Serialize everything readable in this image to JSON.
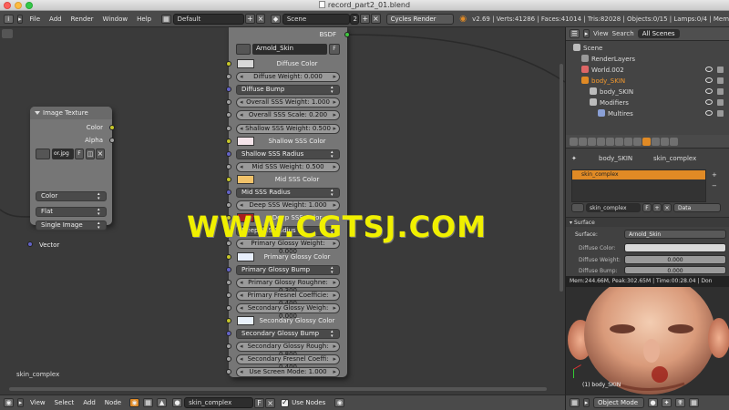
{
  "window": {
    "title": "record_part2_01.blend"
  },
  "info_header": {
    "menus": [
      "File",
      "Add",
      "Render",
      "Window",
      "Help"
    ],
    "screen_layout": "Default",
    "scene": "Scene",
    "scene_users": "2",
    "render_engine": "Cycles Render",
    "stats": "v2.69 | Verts:41286 | Faces:41014 | Tris:82028 | Objects:0/15 | Lamps:0/4 | Mem"
  },
  "image_texture_node": {
    "title": "Image Texture",
    "outputs": [
      "Color",
      "Alpha"
    ],
    "image_name": "or.jpg",
    "image_flag": "F",
    "color_space": "Color",
    "projection": "Flat",
    "source": "Single Image",
    "input": "Vector"
  },
  "shader_node": {
    "output_label": "BSDF",
    "shader_name": "Arnold_Skin",
    "shader_flag": "F",
    "rows": {
      "diffuse_color": "Diffuse Color",
      "diffuse_weight": "Diffuse Weight: 0.000",
      "diffuse_bump": "Diffuse Bump",
      "overall_sss_weight": "Overall SSS Weight: 1.000",
      "overall_sss_scale": "Overall SSS Scale: 0.200",
      "shallow_sss_weight": "Shallow SSS Weight: 0.500",
      "shallow_sss_color": "Shallow SSS Color",
      "shallow_sss_radius": "Shallow SSS Radius",
      "mid_sss_weight": "Mid SSS Weight: 0.500",
      "mid_sss_color": "Mid SSS Color",
      "mid_sss_radius": "Mid SSS Radius",
      "deep_sss_weight": "Deep SSS Weight: 1.000",
      "deep_sss_color": "Deep SSS Color",
      "deep_sss_radius": "Deep SSS Radius",
      "primary_glossy_weight": "Primary Glossy Weight: 0.000",
      "primary_glossy_color": "Primary Glossy Color",
      "primary_glossy_bump": "Primary Glossy Bump",
      "primary_glossy_rough": "Primary Glossy Roughne: 0.300",
      "primary_fresnel": "Primary Fresnel Coefficie: 0.400",
      "secondary_glossy_weight": "Secondary Glossy Weigh: 0.000",
      "secondary_glossy_color": "Secondary Glossy Color",
      "secondary_glossy_bump": "Secondary Glossy Bump",
      "secondary_glossy_rough": "Secondary Glossy Rough: 0.800",
      "secondary_fresnel": "Secondary Fresnel Coeffi: 0.400",
      "use_screen_mode": "Use Screen Mode: 1.000"
    },
    "swatch_colors": {
      "diffuse": "#d8d8d8",
      "shallow_sss": "#f4e4ea",
      "mid_sss": "#f2c36a",
      "deep_sss": "#a8201e",
      "primary_glossy": "#e7eefb",
      "secondary_glossy": "#e9f1fb"
    }
  },
  "node_editor": {
    "material_label": "skin_complex",
    "footer": {
      "menus": [
        "View",
        "Select",
        "Add",
        "Node"
      ],
      "material": "skin_complex",
      "material_flag": "F",
      "use_nodes": "Use Nodes"
    }
  },
  "outliner": {
    "header_tabs": [
      "View",
      "Search"
    ],
    "scope": "All Scenes",
    "items": [
      {
        "label": "Scene",
        "indent": 0,
        "color": "#bbbbbb"
      },
      {
        "label": "RenderLayers",
        "indent": 1,
        "color": "#9a9a9a"
      },
      {
        "label": "World.002",
        "indent": 1,
        "color": "#d66"
      },
      {
        "label": "body_SKIN",
        "indent": 1,
        "color": "#e08a25",
        "highlight": true
      },
      {
        "label": "body_SKIN",
        "indent": 2,
        "color": "#bbbbbb"
      },
      {
        "label": "Modifiers",
        "indent": 2,
        "color": "#bbbbbb"
      },
      {
        "label": "Multires",
        "indent": 3,
        "color": "#8aa0d6"
      }
    ]
  },
  "properties": {
    "breadcrumb": [
      "body_SKIN",
      "skin_complex"
    ],
    "slot": "skin_complex",
    "material": "skin_complex",
    "material_flag": "F",
    "link": "Data",
    "section": "Surface",
    "surface_label": "Surface:",
    "surface_value": "Arnold_Skin",
    "diffuse_color_label": "Diffuse Color:",
    "diffuse_weight_label": "Diffuse Weight:",
    "diffuse_weight_value": "0.000",
    "diffuse_bump_label": "Diffuse Bump:",
    "diffuse_bump_value": "0.000"
  },
  "viewport": {
    "render_info": "Mem:244.66M, Peak:302.65M | Time:00:28.04 | Don",
    "object_label": "(1) body_SKIN",
    "mode": "Object Mode"
  },
  "watermark": "WWW.CGTSJ.COM"
}
